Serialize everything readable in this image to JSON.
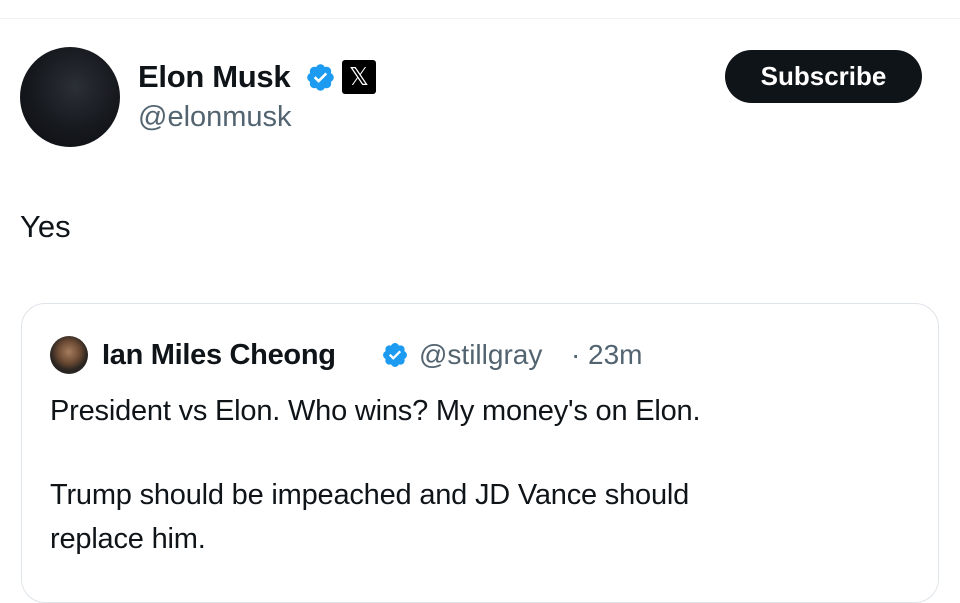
{
  "tweet": {
    "author": {
      "name": "Elon Musk",
      "handle": "@elonmusk",
      "verified_icon": "verified-badge-icon",
      "affiliation_icon": "x-logo-icon",
      "affiliation_glyph": "𝕏"
    },
    "subscribe_label": "Subscribe",
    "text": "Yes"
  },
  "quote": {
    "author": {
      "name": "Ian Miles Cheong",
      "handle": "@stillgray",
      "verified_icon": "verified-badge-icon"
    },
    "separator": "·",
    "time": "23m",
    "lines": [
      "President vs Elon. Who wins? My money's on Elon.",
      "Trump should be impeached and JD Vance should",
      "replace him."
    ]
  },
  "colors": {
    "verified_blue": "#1d9bf0",
    "text_primary": "#0f1419",
    "text_secondary": "#536471",
    "button_bg": "#0f1419",
    "card_border": "#dfe4e8"
  }
}
